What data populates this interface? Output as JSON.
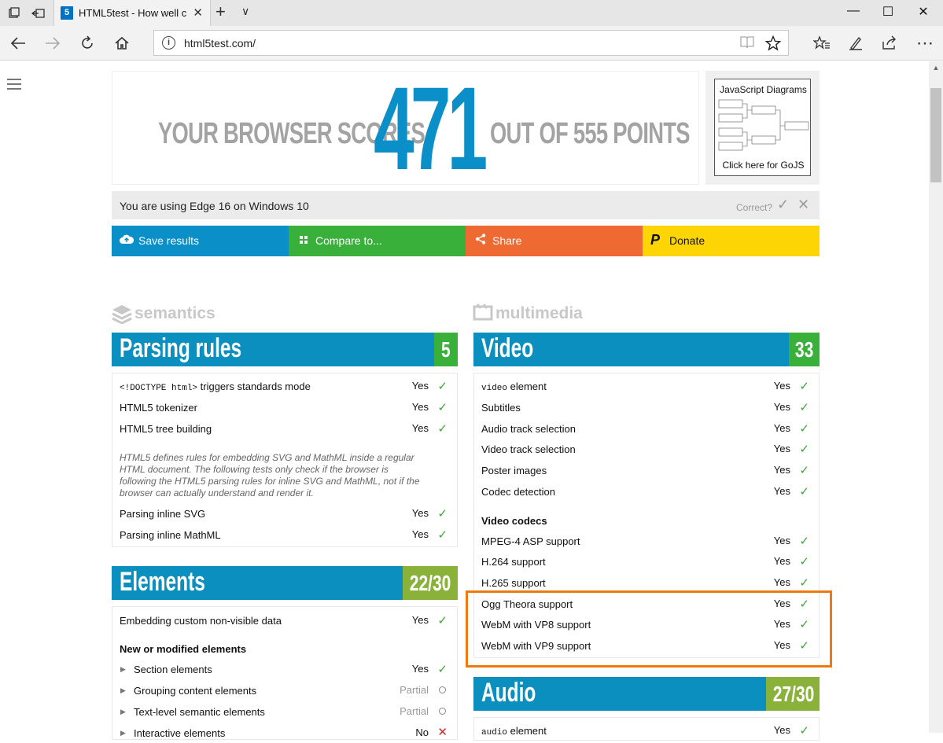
{
  "browser": {
    "tab_title": "HTML5test - How well c",
    "tab_favicon": "5",
    "url": "html5test.com/",
    "tab_close": "✕",
    "new_tab": "+",
    "tab_menu": "∨"
  },
  "score": {
    "left_text": "YOUR BROWSER SCORES",
    "value": "471",
    "right_text": "OUT OF 555 POINTS"
  },
  "ad": {
    "title": "JavaScript Diagrams",
    "cta": "Click here for GoJS"
  },
  "using": {
    "text": "You are using Edge 16 on Windows 10",
    "correct_label": "Correct?"
  },
  "actions": [
    {
      "label": "Save results",
      "color": "#0a8fc8",
      "icon": "cloud-upload-icon"
    },
    {
      "label": "Compare to...",
      "color": "#39b03a",
      "icon": "grid-icon"
    },
    {
      "label": "Share",
      "color": "#ef6a32",
      "icon": "share-icon"
    },
    {
      "label": "Donate",
      "color": "#fed504",
      "icon": "paypal-icon"
    }
  ],
  "categories": {
    "left": "semantics",
    "right": "multimedia"
  },
  "parsing": {
    "title": "Parsing rules",
    "score": "5",
    "score_color": "#39b03a",
    "rows": [
      {
        "code": "<!DOCTYPE html>",
        "name": " triggers standards mode",
        "value": "Yes"
      },
      {
        "name": "HTML5 tokenizer",
        "value": "Yes"
      },
      {
        "name": "HTML5 tree building",
        "value": "Yes"
      }
    ],
    "note": "HTML5 defines rules for embedding SVG and MathML inside a regular HTML document. The following tests only check if the browser is following the HTML5 parsing rules for inline SVG and MathML, not if the browser can actually understand and render it.",
    "rows2": [
      {
        "name": "Parsing inline SVG",
        "value": "Yes"
      },
      {
        "name": "Parsing inline MathML",
        "value": "Yes"
      }
    ]
  },
  "elements": {
    "title": "Elements",
    "score": "22/30",
    "score_color": "#8ab23a",
    "row1": {
      "name": "Embedding custom non-visible data",
      "value": "Yes"
    },
    "subhead": "New or modified elements",
    "rows": [
      {
        "name": "Section elements",
        "value": "Yes"
      },
      {
        "name": "Grouping content elements",
        "value": "Partial"
      },
      {
        "name": "Text-level semantic elements",
        "value": "Partial"
      },
      {
        "name": "Interactive elements",
        "value": "No"
      }
    ]
  },
  "video": {
    "title": "Video",
    "score": "33",
    "score_color": "#39b03a",
    "rows": [
      {
        "code": "video",
        "name": " element",
        "value": "Yes"
      },
      {
        "name": "Subtitles",
        "value": "Yes"
      },
      {
        "name": "Audio track selection",
        "value": "Yes"
      },
      {
        "name": "Video track selection",
        "value": "Yes"
      },
      {
        "name": "Poster images",
        "value": "Yes"
      },
      {
        "name": "Codec detection",
        "value": "Yes"
      }
    ],
    "subhead": "Video codecs",
    "codecs": [
      {
        "name": "MPEG-4 ASP support",
        "value": "Yes"
      },
      {
        "name": "H.264 support",
        "value": "Yes"
      },
      {
        "name": "H.265 support",
        "value": "Yes"
      },
      {
        "name": "Ogg Theora support",
        "value": "Yes"
      },
      {
        "name": "WebM with VP8 support",
        "value": "Yes"
      },
      {
        "name": "WebM with VP9 support",
        "value": "Yes"
      }
    ]
  },
  "audio": {
    "title": "Audio",
    "score": "27/30",
    "score_color": "#8ab23a",
    "row1": {
      "code": "audio",
      "name": " element",
      "value": "Yes"
    }
  }
}
